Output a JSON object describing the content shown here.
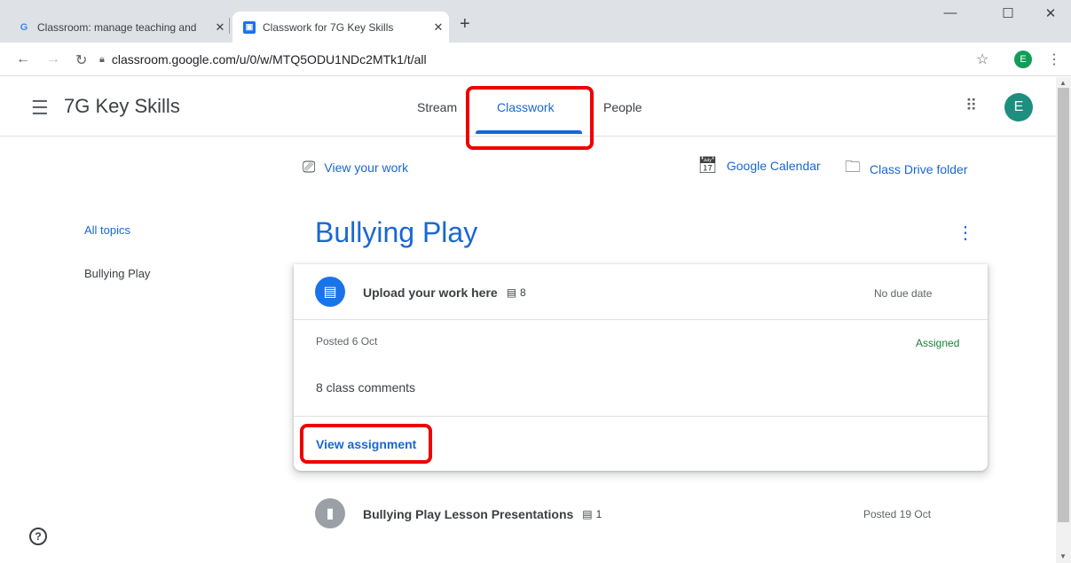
{
  "browser": {
    "tabs": [
      {
        "title": "Classroom: manage teaching and",
        "close": "✕"
      },
      {
        "title": "Classwork for 7G Key Skills",
        "close": "✕"
      }
    ],
    "new_tab": "+",
    "url": "classroom.google.com/u/0/w/MTQ5ODU1NDc2MTk1/t/all",
    "profile_initial": "E"
  },
  "header": {
    "class_name": "7G Key Skills",
    "tabs": [
      {
        "label": "Stream"
      },
      {
        "label": "Classwork"
      },
      {
        "label": "People"
      }
    ],
    "avatar_initial": "E"
  },
  "actions": {
    "view_work": "View your work",
    "calendar": "Google Calendar",
    "drive": "Class Drive folder"
  },
  "topics": [
    {
      "label": "All topics"
    },
    {
      "label": "Bullying Play"
    }
  ],
  "section": {
    "title": "Bullying Play",
    "expanded_item": {
      "title": "Upload your work here",
      "comment_count": "8",
      "due": "No due date",
      "posted": "Posted 6 Oct",
      "status": "Assigned",
      "class_comments": "8 class comments",
      "view_link": "View assignment"
    },
    "items": [
      {
        "title": "Bullying Play Lesson Presentations",
        "comment_count": "1",
        "posted": "Posted 19 Oct"
      }
    ]
  },
  "colors": {
    "accent": "#1967d2",
    "assigned": "#188038",
    "highlight": "#ee0000"
  }
}
